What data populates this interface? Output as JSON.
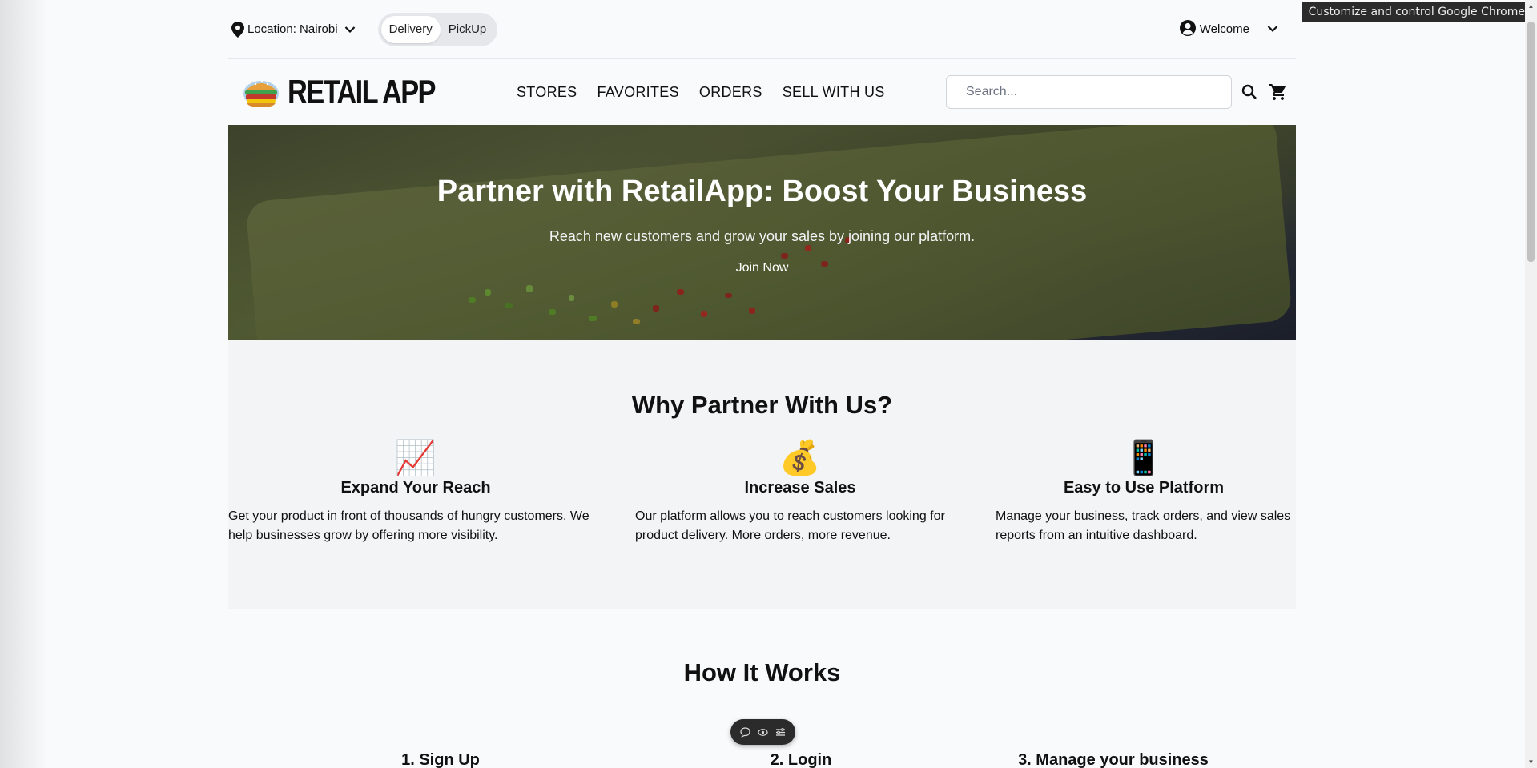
{
  "topbar": {
    "location_label": "Location: Nairobi",
    "delivery_label": "Delivery",
    "pickup_label": "PickUp",
    "welcome_label": "Welcome"
  },
  "navbar": {
    "brand": "RETAIL APP",
    "links": [
      "STORES",
      "FAVORITES",
      "ORDERS",
      "SELL WITH US"
    ],
    "search_placeholder": "Search..."
  },
  "hero": {
    "title": "Partner with RetailApp: Boost Your Business",
    "subtitle": "Reach new customers and grow your sales by joining our platform.",
    "cta": "Join Now"
  },
  "why": {
    "title": "Why Partner With Us?",
    "features": [
      {
        "icon": "chart-increasing-icon",
        "emoji": "📈",
        "title": "Expand Your Reach",
        "text": "Get your product in front of thousands of hungry customers. We help businesses grow by offering more visibility."
      },
      {
        "icon": "money-bag-icon",
        "emoji": "💰",
        "title": "Increase Sales",
        "text": "Our platform allows you to reach customers looking for product delivery. More orders, more revenue."
      },
      {
        "icon": "mobile-phone-icon",
        "emoji": "📱",
        "title": "Easy to Use Platform",
        "text": "Manage your business, track orders, and view sales reports from an intuitive dashboard."
      }
    ]
  },
  "how": {
    "title": "How It Works",
    "steps": [
      "1. Sign Up",
      "2. Login",
      "3. Manage your business"
    ]
  },
  "browser": {
    "tooltip": "Customize and control Google Chrome"
  }
}
